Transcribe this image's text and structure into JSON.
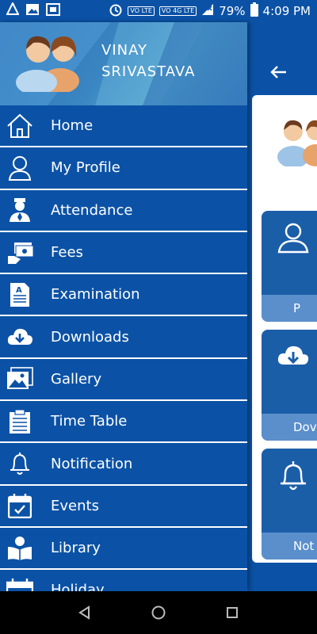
{
  "status_bar": {
    "battery": "79%",
    "time": "4:09 PM",
    "sim1": "VO LTE",
    "sim2": "VO 4G LTE"
  },
  "drawer": {
    "user_name_line1": "VINAY",
    "user_name_line2": "SRIVASTAVA",
    "items": [
      {
        "label": "Home",
        "icon": "home-icon"
      },
      {
        "label": "My Profile",
        "icon": "user-icon"
      },
      {
        "label": "Attendance",
        "icon": "attendance-icon"
      },
      {
        "label": "Fees",
        "icon": "fees-icon"
      },
      {
        "label": "Examination",
        "icon": "examination-icon"
      },
      {
        "label": "Downloads",
        "icon": "cloud-download-icon"
      },
      {
        "label": "Gallery",
        "icon": "gallery-icon"
      },
      {
        "label": "Time Table",
        "icon": "timetable-icon"
      },
      {
        "label": "Notification",
        "icon": "bell-icon"
      },
      {
        "label": "Events",
        "icon": "calendar-icon"
      },
      {
        "label": "Library",
        "icon": "library-icon"
      },
      {
        "label": "Holiday",
        "icon": "holiday-icon"
      }
    ]
  },
  "background_screen": {
    "tiles": [
      {
        "label": "P",
        "icon": "user-icon"
      },
      {
        "label": "Dov",
        "icon": "cloud-download-icon"
      },
      {
        "label": "Not",
        "icon": "bell-icon"
      }
    ]
  },
  "colors": {
    "primary": "#0b52a6",
    "tile": "#1b5ea8",
    "tile_label": "#5a8fcb"
  }
}
